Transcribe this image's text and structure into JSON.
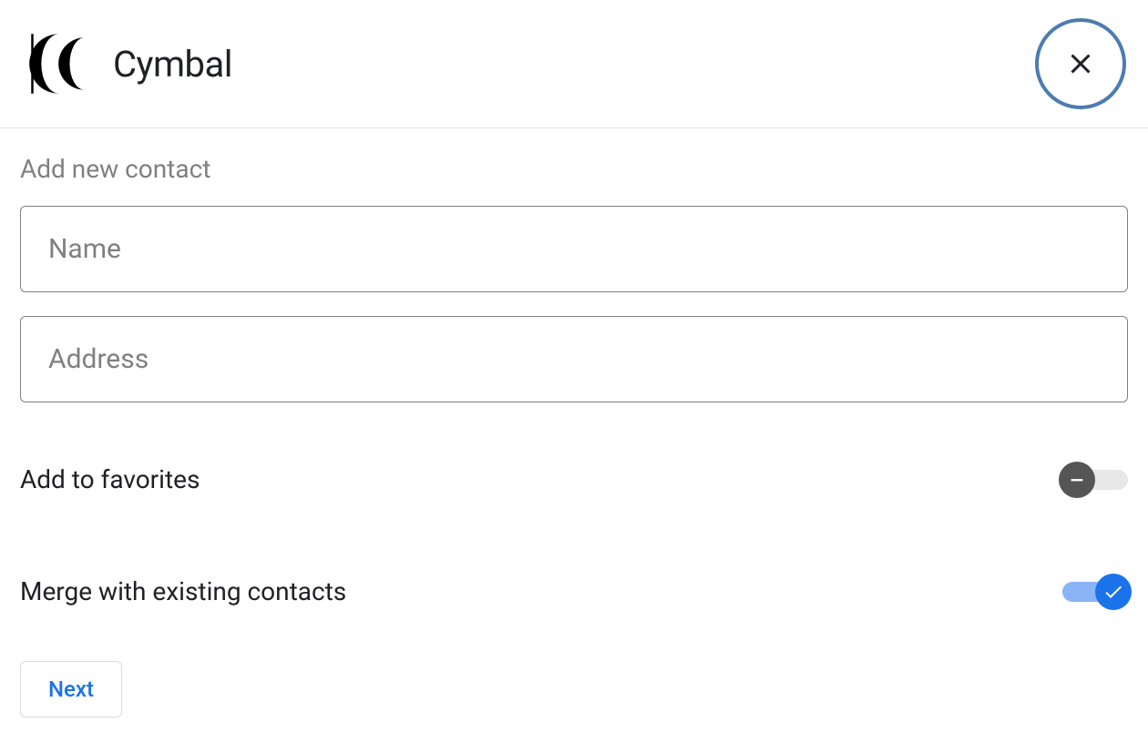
{
  "header": {
    "brand_name": "Cymbal"
  },
  "form": {
    "title": "Add new contact",
    "name_placeholder": "Name",
    "name_value": "",
    "address_placeholder": "Address",
    "address_value": "",
    "favorites_label": "Add to favorites",
    "favorites_on": false,
    "merge_label": "Merge with existing contacts",
    "merge_on": true,
    "next_label": "Next"
  },
  "icons": {
    "close": "close-icon",
    "minus": "minus-icon",
    "check": "check-icon"
  }
}
